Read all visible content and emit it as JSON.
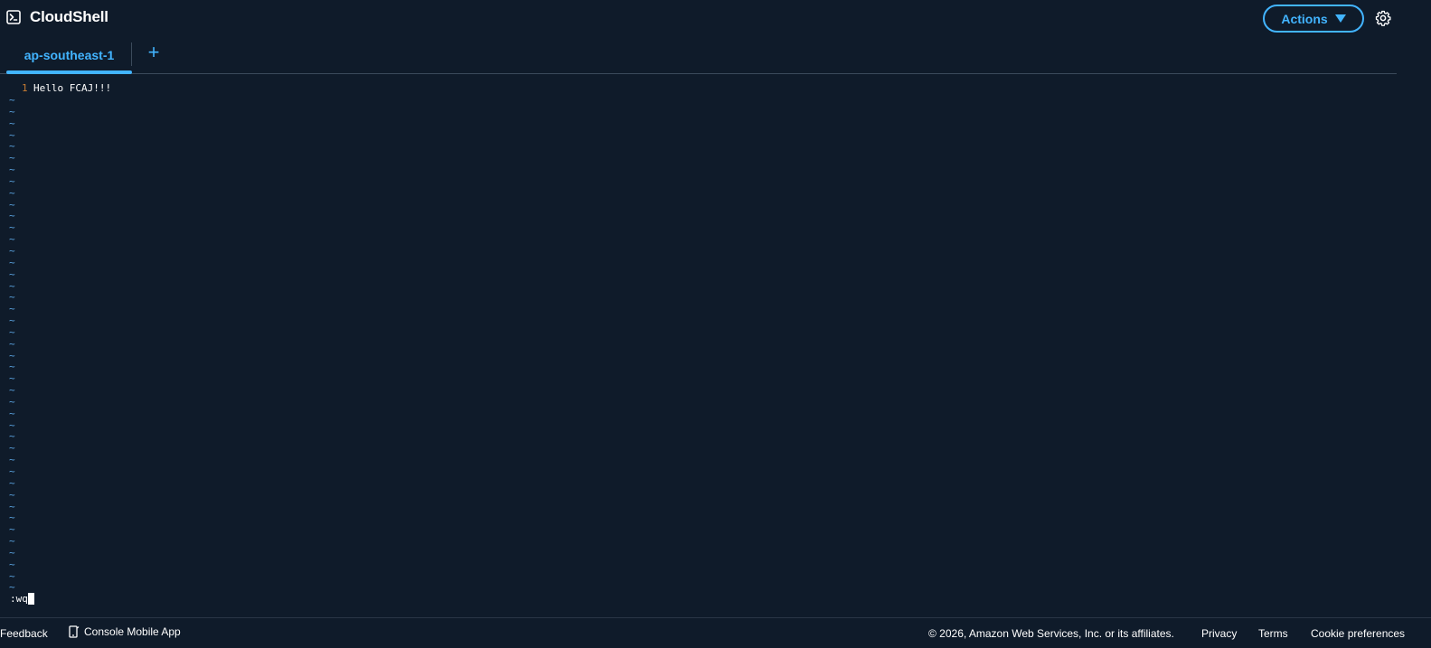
{
  "header": {
    "title": "CloudShell",
    "title_icon": "terminal-icon",
    "actions_label": "Actions",
    "settings_icon": "gear-icon"
  },
  "tabs": {
    "items": [
      {
        "label": "ap-southeast-1",
        "active": true
      }
    ],
    "add_icon": "plus-icon"
  },
  "terminal": {
    "lines": [
      {
        "number": "1",
        "text": "Hello FCAJ!!!"
      }
    ],
    "empty_line_marker": "~",
    "command": ":wq"
  },
  "footer": {
    "feedback": "Feedback",
    "mobile_app": "Console Mobile App",
    "copyright": "© 2026, Amazon Web Services, Inc. or its affiliates.",
    "privacy": "Privacy",
    "terms": "Terms",
    "cookie": "Cookie preferences"
  },
  "colors": {
    "background": "#0f1b2a",
    "accent": "#42b4ff",
    "line_number": "#c87d33",
    "tilde": "#5aa3e0"
  }
}
